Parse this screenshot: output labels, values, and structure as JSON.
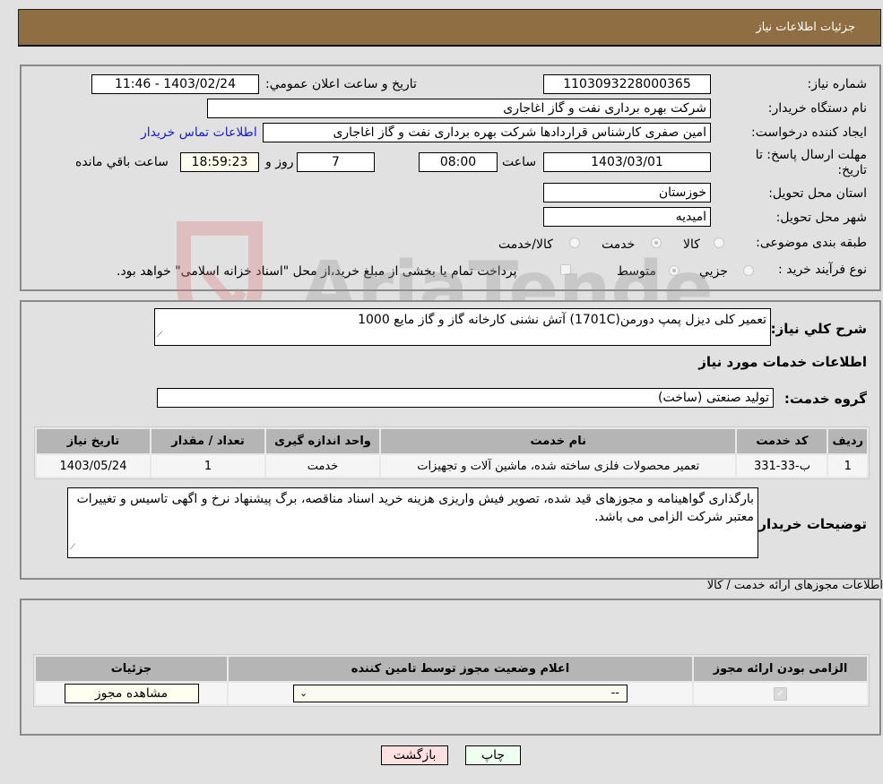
{
  "header": {
    "title": "جزئیات اطلاعات نیاز"
  },
  "info": {
    "need_number_label": "شماره نیاز:",
    "need_number": "1103093228000365",
    "announce_label": "تاریخ و ساعت اعلان عمومي:",
    "announce_value": "1403/02/24 - 11:46",
    "buyer_label": "نام دستگاه خریدار:",
    "buyer_value": "شرکت بهره برداری نفت و گاز اغاجاری",
    "creator_label": "ایجاد کننده درخواست:",
    "creator_value": "امین صفری کارشناس قراردادها شرکت بهره برداری نفت و گاز اغاجاری",
    "contact_link": "اطلاعات تماس خریدار",
    "deadline_label_1": "مهلت ارسال پاسخ: تا",
    "deadline_label_2": "تاریخ:",
    "deadline_date": "1403/03/01",
    "time_label": "ساعت",
    "deadline_time": "08:00",
    "days_value": "7",
    "days_label": "روز و",
    "remaining_time": "18:59:23",
    "remaining_label": "ساعت باقي مانده",
    "province_label": "استان محل تحویل:",
    "province_value": "خوزستان",
    "city_label": "شهر محل تحویل:",
    "city_value": "امیدیه",
    "category_label": "طبقه بندی موضوعی:",
    "category_options": [
      {
        "label": "کالا",
        "checked": false
      },
      {
        "label": "خدمت",
        "checked": true
      },
      {
        "label": "کالا/خدمت",
        "checked": false
      }
    ],
    "process_label": "نوع فرآیند خرید :",
    "process_options": [
      {
        "label": "جزيي",
        "checked": false
      },
      {
        "label": "متوسط",
        "checked": true
      }
    ],
    "treasury_note": "پرداخت تمام یا بخشی از مبلغ خرید،از محل \"اسناد خزانه اسلامی\" خواهد بود."
  },
  "description": {
    "label": "شرح کلي نياز:",
    "value": "تعمیر کلی دیزل پمپ دورمن(1701C) آتش نشنی کارخانه گاز و گاز مایع 1000",
    "services_heading": "اطلاعات خدمات مورد نياز",
    "group_label": "گروه خدمت:",
    "group_value": "تولید صنعتی (ساخت)"
  },
  "services_table": {
    "headers": [
      "رديف",
      "کد خدمت",
      "نام خدمت",
      "واحد اندازه گیری",
      "تعداد / مقدار",
      "تاریخ نیاز"
    ],
    "rows": [
      [
        "1",
        "ب-33-331",
        "تعمیر محصولات فلزی ساخته شده، ماشین آلات و تجهیزات",
        "خدمت",
        "1",
        "1403/05/24"
      ]
    ]
  },
  "buyer_notes": {
    "label": "توضیحات خریدار:",
    "value": "بارگذاری گواهینامه و مجوزهای قید شده، تصویر فیش واریزی هزینه خرید اسناد مناقصه، برگ پیشنهاد نرخ و اگهی تاسیس و تغییرات معتبر شرکت الزامی می باشد."
  },
  "permits": {
    "section_title": "اطلاعات مجوزهای ارائه خدمت / کالا",
    "headers": [
      "الزامی بودن ارائه مجوز",
      "اعلام وضعیت مجوز توسط تامین کننده",
      "جزئیات"
    ],
    "row": {
      "required_checked": true,
      "status_value": "--",
      "details_button": "مشاهده مجوز"
    }
  },
  "footer": {
    "print_label": "چاپ",
    "back_label": "بازگشت"
  },
  "watermark": {
    "text": "AriaTender.neT"
  }
}
